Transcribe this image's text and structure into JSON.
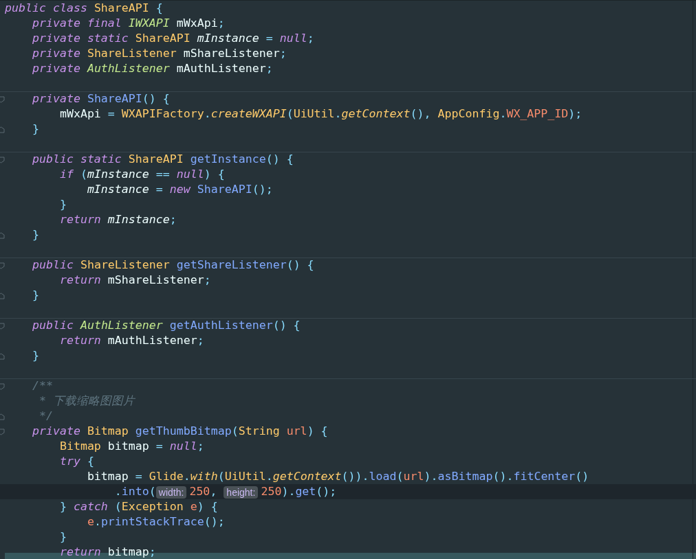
{
  "editor": {
    "lines": [
      {
        "selected": false,
        "separator": false,
        "fold_start": false,
        "fold_end": false,
        "tokens": [
          {
            "text": "public class ",
            "kind": "kw"
          },
          {
            "text": "ShareAPI ",
            "kind": "type"
          },
          {
            "text": "{",
            "kind": "punc"
          }
        ]
      },
      {
        "selected": false,
        "separator": false,
        "fold_start": false,
        "fold_end": false,
        "tokens": [
          {
            "text": "    private final ",
            "kind": "kw"
          },
          {
            "text": "IWXAPI",
            "kind": "iface"
          },
          {
            "text": " mWxApi",
            "kind": "plain"
          },
          {
            "text": ";",
            "kind": "punc"
          }
        ]
      },
      {
        "selected": false,
        "separator": false,
        "fold_start": false,
        "fold_end": false,
        "tokens": [
          {
            "text": "    private static ",
            "kind": "kw"
          },
          {
            "text": "ShareAPI ",
            "kind": "type"
          },
          {
            "text": "mInstance",
            "kind": "field"
          },
          {
            "text": " = ",
            "kind": "punc"
          },
          {
            "text": "null",
            "kind": "kw"
          },
          {
            "text": ";",
            "kind": "punc"
          }
        ]
      },
      {
        "selected": false,
        "separator": false,
        "fold_start": false,
        "fold_end": false,
        "tokens": [
          {
            "text": "    private ",
            "kind": "kw"
          },
          {
            "text": "ShareListener",
            "kind": "type"
          },
          {
            "text": " mShareListener",
            "kind": "plain"
          },
          {
            "text": ";",
            "kind": "punc"
          }
        ]
      },
      {
        "selected": false,
        "separator": false,
        "fold_start": false,
        "fold_end": false,
        "tokens": [
          {
            "text": "    private ",
            "kind": "kw"
          },
          {
            "text": "AuthListener",
            "kind": "iface"
          },
          {
            "text": " mAuthListener",
            "kind": "plain"
          },
          {
            "text": ";",
            "kind": "punc"
          }
        ]
      },
      {
        "selected": false,
        "separator": false,
        "fold_start": false,
        "fold_end": false
      },
      {
        "selected": false,
        "separator": true,
        "fold_start": true,
        "fold_end": false,
        "tokens": [
          {
            "text": "    private ",
            "kind": "kw"
          },
          {
            "text": "ShareAPI",
            "kind": "fn"
          },
          {
            "text": "() {",
            "kind": "punc"
          }
        ]
      },
      {
        "selected": false,
        "separator": false,
        "fold_start": false,
        "fold_end": false,
        "tokens": [
          {
            "text": "        mWxApi ",
            "kind": "plain"
          },
          {
            "text": "= ",
            "kind": "punc"
          },
          {
            "text": "WXAPIFactory",
            "kind": "type"
          },
          {
            "text": ".",
            "kind": "punc"
          },
          {
            "text": "createWXAPI",
            "kind": "call"
          },
          {
            "text": "(",
            "kind": "punc"
          },
          {
            "text": "UiUtil",
            "kind": "type"
          },
          {
            "text": ".",
            "kind": "punc"
          },
          {
            "text": "getContext",
            "kind": "call"
          },
          {
            "text": "(), ",
            "kind": "punc"
          },
          {
            "text": "AppConfig",
            "kind": "type"
          },
          {
            "text": ".",
            "kind": "punc"
          },
          {
            "text": "WX_APP_ID",
            "kind": "const"
          },
          {
            "text": ");",
            "kind": "punc"
          }
        ]
      },
      {
        "selected": false,
        "separator": false,
        "fold_start": false,
        "fold_end": true,
        "tokens": [
          {
            "text": "    }",
            "kind": "punc"
          }
        ]
      },
      {
        "selected": false,
        "separator": false,
        "fold_start": false,
        "fold_end": false
      },
      {
        "selected": false,
        "separator": true,
        "fold_start": true,
        "fold_end": false,
        "tokens": [
          {
            "text": "    public static ",
            "kind": "kw"
          },
          {
            "text": "ShareAPI ",
            "kind": "type"
          },
          {
            "text": "getInstance",
            "kind": "fn"
          },
          {
            "text": "() {",
            "kind": "punc"
          }
        ]
      },
      {
        "selected": false,
        "separator": false,
        "fold_start": false,
        "fold_end": false,
        "tokens": [
          {
            "text": "        if ",
            "kind": "kw"
          },
          {
            "text": "(",
            "kind": "punc"
          },
          {
            "text": "mInstance",
            "kind": "field"
          },
          {
            "text": " == ",
            "kind": "punc"
          },
          {
            "text": "null",
            "kind": "kw"
          },
          {
            "text": ") {",
            "kind": "punc"
          }
        ]
      },
      {
        "selected": false,
        "separator": false,
        "fold_start": false,
        "fold_end": false,
        "tokens": [
          {
            "text": "            mInstance",
            "kind": "field"
          },
          {
            "text": " = ",
            "kind": "punc"
          },
          {
            "text": "new ",
            "kind": "kw"
          },
          {
            "text": "ShareAPI",
            "kind": "fn"
          },
          {
            "text": "();",
            "kind": "punc"
          }
        ]
      },
      {
        "selected": false,
        "separator": false,
        "fold_start": false,
        "fold_end": false,
        "tokens": [
          {
            "text": "        }",
            "kind": "punc"
          }
        ]
      },
      {
        "selected": false,
        "separator": false,
        "fold_start": false,
        "fold_end": false,
        "tokens": [
          {
            "text": "        return ",
            "kind": "kw"
          },
          {
            "text": "mInstance",
            "kind": "field"
          },
          {
            "text": ";",
            "kind": "punc"
          }
        ]
      },
      {
        "selected": false,
        "separator": false,
        "fold_start": false,
        "fold_end": true,
        "tokens": [
          {
            "text": "    }",
            "kind": "punc"
          }
        ]
      },
      {
        "selected": false,
        "separator": false,
        "fold_start": false,
        "fold_end": false
      },
      {
        "selected": false,
        "separator": true,
        "fold_start": true,
        "fold_end": false,
        "tokens": [
          {
            "text": "    public ",
            "kind": "kw"
          },
          {
            "text": "ShareListener ",
            "kind": "type"
          },
          {
            "text": "getShareListener",
            "kind": "fn"
          },
          {
            "text": "() {",
            "kind": "punc"
          }
        ]
      },
      {
        "selected": false,
        "separator": false,
        "fold_start": false,
        "fold_end": false,
        "tokens": [
          {
            "text": "        return ",
            "kind": "kw"
          },
          {
            "text": "mShareListener",
            "kind": "plain"
          },
          {
            "text": ";",
            "kind": "punc"
          }
        ]
      },
      {
        "selected": false,
        "separator": false,
        "fold_start": false,
        "fold_end": true,
        "tokens": [
          {
            "text": "    }",
            "kind": "punc"
          }
        ]
      },
      {
        "selected": false,
        "separator": false,
        "fold_start": false,
        "fold_end": false
      },
      {
        "selected": false,
        "separator": true,
        "fold_start": true,
        "fold_end": false,
        "tokens": [
          {
            "text": "    public ",
            "kind": "kw"
          },
          {
            "text": "AuthListener ",
            "kind": "iface"
          },
          {
            "text": "getAuthListener",
            "kind": "fn"
          },
          {
            "text": "() {",
            "kind": "punc"
          }
        ]
      },
      {
        "selected": false,
        "separator": false,
        "fold_start": false,
        "fold_end": false,
        "tokens": [
          {
            "text": "        return ",
            "kind": "kw"
          },
          {
            "text": "mAuthListener",
            "kind": "plain"
          },
          {
            "text": ";",
            "kind": "punc"
          }
        ]
      },
      {
        "selected": false,
        "separator": false,
        "fold_start": false,
        "fold_end": true,
        "tokens": [
          {
            "text": "    }",
            "kind": "punc"
          }
        ]
      },
      {
        "selected": false,
        "separator": false,
        "fold_start": false,
        "fold_end": false
      },
      {
        "selected": false,
        "separator": true,
        "fold_start": true,
        "fold_end": false,
        "tokens": [
          {
            "text": "    /**",
            "kind": "comment"
          }
        ]
      },
      {
        "selected": false,
        "separator": false,
        "fold_start": false,
        "fold_end": false,
        "tokens": [
          {
            "text": "     * 下载缩略图图片",
            "kind": "comment"
          }
        ]
      },
      {
        "selected": false,
        "separator": false,
        "fold_start": false,
        "fold_end": true,
        "tokens": [
          {
            "text": "     */",
            "kind": "comment"
          }
        ]
      },
      {
        "selected": false,
        "separator": false,
        "fold_start": true,
        "fold_end": false,
        "tokens": [
          {
            "text": "    private ",
            "kind": "kw"
          },
          {
            "text": "Bitmap ",
            "kind": "type"
          },
          {
            "text": "getThumbBitmap",
            "kind": "fn"
          },
          {
            "text": "(",
            "kind": "punc"
          },
          {
            "text": "String ",
            "kind": "type"
          },
          {
            "text": "url",
            "kind": "param"
          },
          {
            "text": ") {",
            "kind": "punc"
          }
        ]
      },
      {
        "selected": false,
        "separator": false,
        "fold_start": false,
        "fold_end": false,
        "tokens": [
          {
            "text": "        Bitmap ",
            "kind": "type"
          },
          {
            "text": "bitmap",
            "kind": "plain"
          },
          {
            "text": " = ",
            "kind": "punc"
          },
          {
            "text": "null",
            "kind": "kw"
          },
          {
            "text": ";",
            "kind": "punc"
          }
        ]
      },
      {
        "selected": false,
        "separator": false,
        "fold_start": false,
        "fold_end": false,
        "tokens": [
          {
            "text": "        try ",
            "kind": "kw"
          },
          {
            "text": "{",
            "kind": "punc"
          }
        ]
      },
      {
        "selected": false,
        "separator": false,
        "fold_start": false,
        "fold_end": false,
        "tokens": [
          {
            "text": "            bitmap ",
            "kind": "plain"
          },
          {
            "text": "= ",
            "kind": "punc"
          },
          {
            "text": "Glide",
            "kind": "type"
          },
          {
            "text": ".",
            "kind": "punc"
          },
          {
            "text": "with",
            "kind": "call"
          },
          {
            "text": "(",
            "kind": "punc"
          },
          {
            "text": "UiUtil",
            "kind": "type"
          },
          {
            "text": ".",
            "kind": "punc"
          },
          {
            "text": "getContext",
            "kind": "call"
          },
          {
            "text": "()).",
            "kind": "punc"
          },
          {
            "text": "load",
            "kind": "fn"
          },
          {
            "text": "(",
            "kind": "punc"
          },
          {
            "text": "url",
            "kind": "param"
          },
          {
            "text": ").",
            "kind": "punc"
          },
          {
            "text": "asBitmap",
            "kind": "fn"
          },
          {
            "text": "().",
            "kind": "punc"
          },
          {
            "text": "fitCenter",
            "kind": "fn"
          },
          {
            "text": "()",
            "kind": "punc"
          }
        ]
      },
      {
        "selected": true,
        "separator": false,
        "fold_start": false,
        "fold_end": false,
        "tokens": [
          {
            "text": "                .",
            "kind": "punc"
          },
          {
            "text": "into",
            "kind": "fn"
          },
          {
            "text": "(",
            "kind": "punc"
          },
          {
            "text": "width:",
            "kind": "hint"
          },
          {
            "text": "250",
            "kind": "const"
          },
          {
            "text": ", ",
            "kind": "punc"
          },
          {
            "text": "height:",
            "kind": "hint"
          },
          {
            "text": "250",
            "kind": "const"
          },
          {
            "text": ").",
            "kind": "punc"
          },
          {
            "text": "get",
            "kind": "fn"
          },
          {
            "text": "();",
            "kind": "punc"
          }
        ]
      },
      {
        "selected": false,
        "separator": false,
        "fold_start": false,
        "fold_end": false,
        "tokens": [
          {
            "text": "        } ",
            "kind": "punc"
          },
          {
            "text": "catch ",
            "kind": "kw"
          },
          {
            "text": "(",
            "kind": "punc"
          },
          {
            "text": "Exception ",
            "kind": "type"
          },
          {
            "text": "e",
            "kind": "param"
          },
          {
            "text": ") {",
            "kind": "punc"
          }
        ]
      },
      {
        "selected": false,
        "separator": false,
        "fold_start": false,
        "fold_end": false,
        "tokens": [
          {
            "text": "            e",
            "kind": "param"
          },
          {
            "text": ".",
            "kind": "punc"
          },
          {
            "text": "printStackTrace",
            "kind": "fn"
          },
          {
            "text": "();",
            "kind": "punc"
          }
        ]
      },
      {
        "selected": false,
        "separator": false,
        "fold_start": false,
        "fold_end": false,
        "tokens": [
          {
            "text": "        }",
            "kind": "punc"
          }
        ]
      },
      {
        "selected": false,
        "separator": false,
        "fold_start": false,
        "fold_end": false,
        "tokens": [
          {
            "text": "        return ",
            "kind": "kw"
          },
          {
            "text": "bitmap",
            "kind": "plain"
          },
          {
            "text": ";",
            "kind": "punc"
          }
        ]
      }
    ]
  }
}
